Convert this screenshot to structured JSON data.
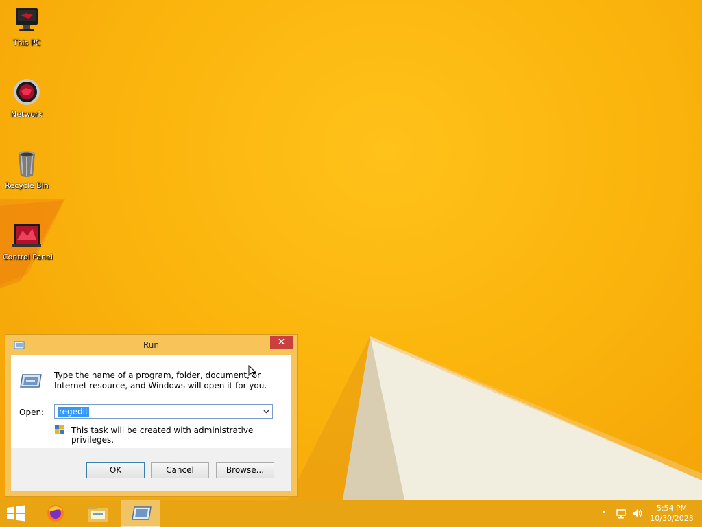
{
  "desktop": {
    "icons": [
      {
        "label": "This PC",
        "icon": "this-pc-icon"
      },
      {
        "label": "Network",
        "icon": "network-icon"
      },
      {
        "label": "Recycle Bin",
        "icon": "recycle-bin-icon"
      },
      {
        "label": "Control Panel",
        "icon": "control-panel-icon"
      }
    ]
  },
  "run_dialog": {
    "title": "Run",
    "description": "Type the name of a program, folder, document, or Internet resource, and Windows will open it for you.",
    "open_label": "Open:",
    "open_value": "regedit",
    "admin_note": "This task will be created with administrative privileges.",
    "buttons": {
      "ok": "OK",
      "cancel": "Cancel",
      "browse": "Browse..."
    },
    "close_glyph": "✕"
  },
  "taskbar": {
    "apps": [
      "firefox-icon",
      "file-explorer-icon",
      "run-icon"
    ],
    "clock": {
      "time": "5:54 PM",
      "date": "10/30/2023"
    }
  },
  "colors": {
    "desktop": "#f7b208",
    "taskbar": "#e8a412",
    "dialog_frame": "#f7c45a",
    "close_button": "#c9403f",
    "selection": "#3399ff"
  }
}
